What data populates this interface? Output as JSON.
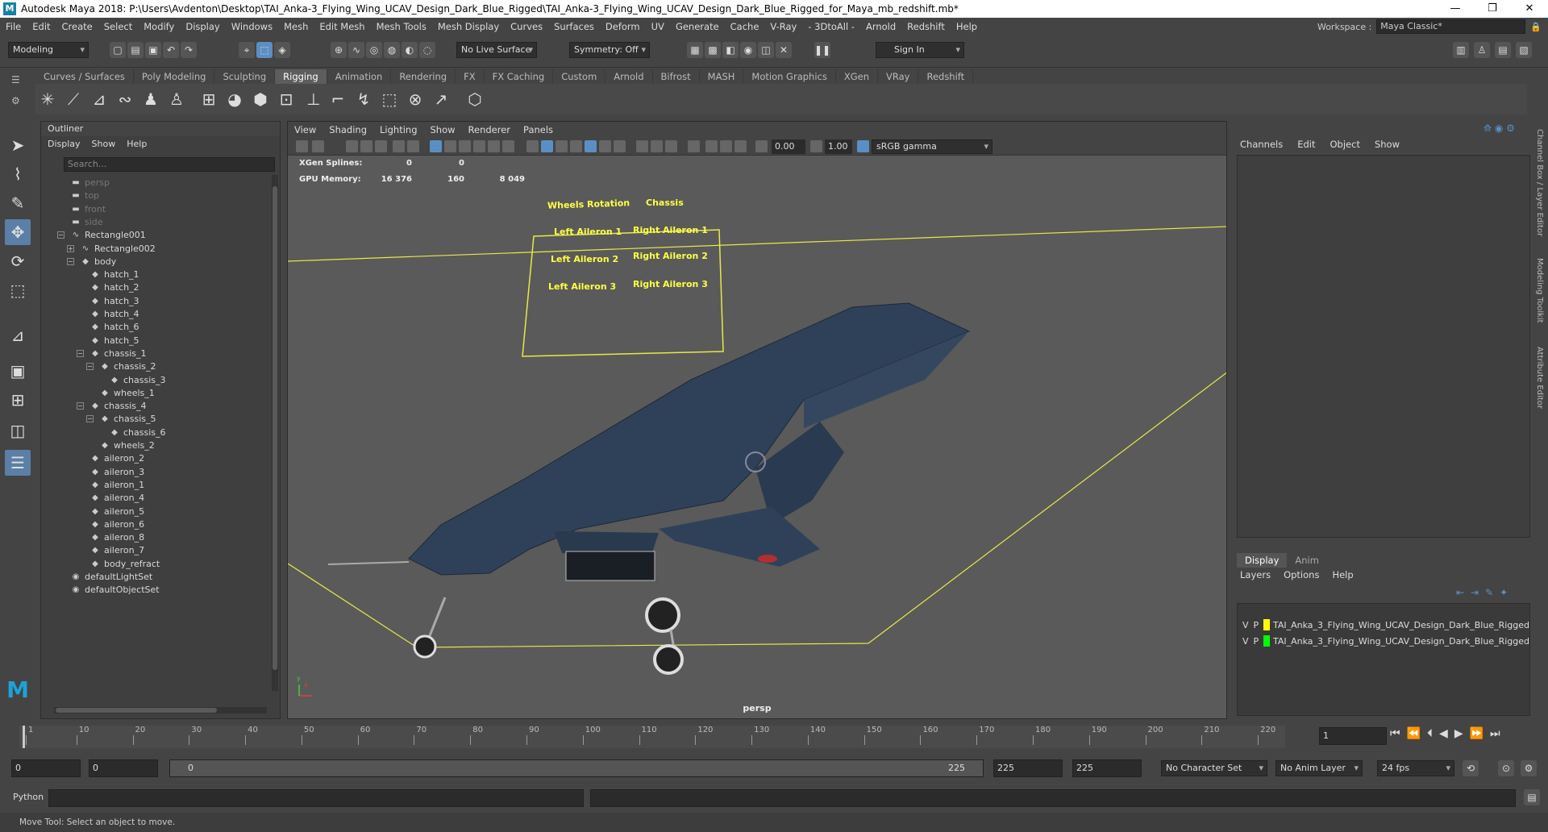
{
  "title": "Autodesk Maya 2018: P:\\Users\\Avdenton\\Desktop\\TAI_Anka-3_Flying_Wing_UCAV_Design_Dark_Blue_Rigged\\TAI_Anka-3_Flying_Wing_UCAV_Design_Dark_Blue_Rigged_for_Maya_mb_redshift.mb*",
  "window_controls": {
    "minimize": "—",
    "maximize": "❐",
    "close": "✕"
  },
  "menu": [
    "File",
    "Edit",
    "Create",
    "Select",
    "Modify",
    "Display",
    "Windows",
    "Mesh",
    "Edit Mesh",
    "Mesh Tools",
    "Mesh Display",
    "Curves",
    "Surfaces",
    "Deform",
    "UV",
    "Generate",
    "Cache",
    "V-Ray",
    "- 3DtoAll -",
    "Arnold",
    "Redshift",
    "Help"
  ],
  "workspace": {
    "label": "Workspace :",
    "value": "Maya Classic*"
  },
  "status": {
    "mode": "Modeling",
    "live_surface": "No Live Surface",
    "symmetry": "Symmetry: Off",
    "sign_in": "Sign In"
  },
  "shelf_tabs": [
    "Curves / Surfaces",
    "Poly Modeling",
    "Sculpting",
    "Rigging",
    "Animation",
    "Rendering",
    "FX",
    "FX Caching",
    "Custom",
    "Arnold",
    "Bifrost",
    "MASH",
    "Motion Graphics",
    "XGen",
    "VRay",
    "Redshift"
  ],
  "shelf_active": "Rigging",
  "outliner": {
    "title": "Outliner",
    "menus": [
      "Display",
      "Show",
      "Help"
    ],
    "search_placeholder": "Search...",
    "items": [
      "persp",
      "top",
      "front",
      "side",
      "Rectangle001",
      "Rectangle002",
      "body",
      "hatch_1",
      "hatch_2",
      "hatch_3",
      "hatch_4",
      "hatch_6",
      "hatch_5",
      "chassis_1",
      "chassis_2",
      "chassis_3",
      "wheels_1",
      "chassis_4",
      "chassis_5",
      "chassis_6",
      "wheels_2",
      "aileron_2",
      "aileron_3",
      "aileron_1",
      "aileron_4",
      "aileron_5",
      "aileron_6",
      "aileron_8",
      "aileron_7",
      "body_refract",
      "defaultLightSet",
      "defaultObjectSet"
    ]
  },
  "viewport": {
    "menus": [
      "View",
      "Shading",
      "Lighting",
      "Show",
      "Renderer",
      "Panels"
    ],
    "exposure": "0.00",
    "gamma": "1.00",
    "color_space": "sRGB gamma",
    "hud": [
      {
        "label": "XGen Splines:",
        "v1": "0",
        "v2": "0",
        "v3": ""
      },
      {
        "label": "GPU Memory:",
        "v1": "16 376",
        "v2": "160",
        "v3": "8 049"
      }
    ],
    "camera": "persp",
    "control_labels": {
      "wheels_rotation": "Wheels Rotation",
      "chassis": "Chassis",
      "left_aileron_1": "Left Aileron 1",
      "right_aileron_1": "Right Aileron 1",
      "left_aileron_2": "Left Aileron 2",
      "right_aileron_2": "Right Aileron 2",
      "left_aileron_3": "Left Aileron 3",
      "right_aileron_3": "Right Aileron 3"
    },
    "axis": {
      "x": "x",
      "y": "y"
    }
  },
  "channel_box": {
    "menus": [
      "Channels",
      "Edit",
      "Object",
      "Show"
    ],
    "side_tabs": [
      "Channel Box / Layer Editor",
      "Modeling Toolkit",
      "Attribute Editor"
    ]
  },
  "layers": {
    "tabs": [
      "Display",
      "Anim"
    ],
    "menus": [
      "Layers",
      "Options",
      "Help"
    ],
    "items": [
      {
        "v": "V",
        "p": "P",
        "color": "#ffff00",
        "name": "TAI_Anka_3_Flying_Wing_UCAV_Design_Dark_Blue_Rigged"
      },
      {
        "v": "V",
        "p": "P",
        "color": "#00ff00",
        "name": "TAI_Anka_3_Flying_Wing_UCAV_Design_Dark_Blue_Rigged"
      }
    ]
  },
  "timeline": {
    "ticks": [
      "1",
      "10",
      "20",
      "30",
      "40",
      "50",
      "60",
      "70",
      "80",
      "90",
      "100",
      "110",
      "120",
      "130",
      "140",
      "150",
      "160",
      "170",
      "180",
      "190",
      "200",
      "210",
      "220"
    ],
    "current_frame": "1",
    "range_start": "0",
    "anim_start": "0",
    "slider_start": "0",
    "slider_end": "225",
    "range_end": "225",
    "anim_end": "225",
    "character_set": "No Character Set",
    "anim_layer": "No Anim Layer",
    "fps": "24 fps"
  },
  "command_line": {
    "label": "Python"
  },
  "help_line": "Move Tool: Select an object to move."
}
